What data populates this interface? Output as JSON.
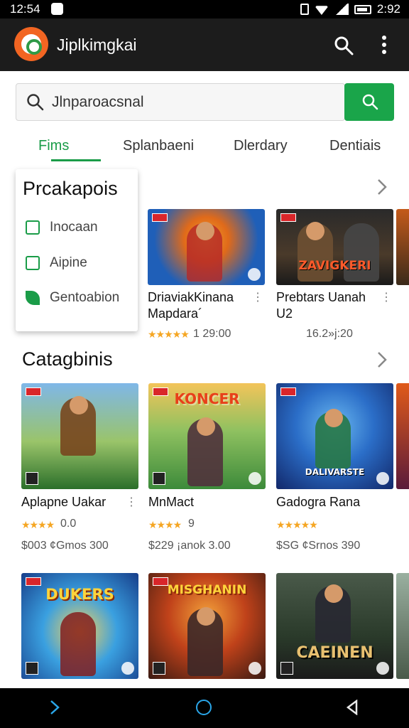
{
  "status_bar": {
    "time_left": "12:54",
    "time_right": "2:92"
  },
  "app_bar": {
    "title": "Jiplkimgkai",
    "icons": [
      "app-logo-icon",
      "search-icon",
      "more-vert-icon"
    ]
  },
  "search": {
    "value": "Jlnparoacsnal",
    "button_icon": "search-icon"
  },
  "tabs": [
    {
      "label": "Fims",
      "active": true
    },
    {
      "label": "Splanbaeni",
      "active": false
    },
    {
      "label": "Dlerdary",
      "active": false
    },
    {
      "label": "Dentiais",
      "active": false
    }
  ],
  "dropdown": {
    "title": "Prcakapois",
    "items": [
      {
        "label": "Inocaan",
        "icon": "square-icon"
      },
      {
        "label": "Aipine",
        "icon": "page-icon"
      },
      {
        "label": "Gentoabion",
        "icon": "leaf-icon"
      }
    ]
  },
  "section1": {
    "cards": [
      {
        "name": "DriaviakKinana Mapdara´",
        "stars": "★★★★★",
        "rating": "1 29:00",
        "art_title": "",
        "colors": [
          "#1f5fb8",
          "#f0a02a"
        ]
      },
      {
        "name": "Prebtars Uanah U2",
        "stars": "",
        "rating": "16.2»j:20",
        "art_title": "ZAVIGKERI",
        "colors": [
          "#1a1a1a",
          "#4a3a2a"
        ]
      }
    ]
  },
  "section2": {
    "title": "Catagbinis",
    "cards": [
      {
        "name": "Aplapne Uakar",
        "stars": "★★★★",
        "rating": "0.0",
        "price": "$003 ¢Gmos 300",
        "art_title": "",
        "colors": [
          "#2b6f2a",
          "#f2a640"
        ]
      },
      {
        "name": "MnMact",
        "stars": "★★★★",
        "rating": "9",
        "price": "$229 ¡anok 3.00",
        "art_title": "KONCER",
        "colors": [
          "#3c8a3a",
          "#e89a30"
        ]
      },
      {
        "name": "Gadogra Rana",
        "stars": "★★★★★",
        "rating": "",
        "price": "$SG ¢Srnos 390",
        "art_title": "DALIVARSTE",
        "colors": [
          "#1c3e8e",
          "#2b8ed8"
        ]
      }
    ]
  },
  "section3": {
    "cards": [
      {
        "art_title": "DUKERS",
        "colors": [
          "#1e4ea8",
          "#f0a02a"
        ]
      },
      {
        "art_title": "MISGHANIN",
        "colors": [
          "#5a2a1a",
          "#e85a20"
        ]
      },
      {
        "art_title": "CAEINEN",
        "colors": [
          "#2a3a2a",
          "#6a7a5a"
        ]
      }
    ]
  },
  "nav_bar": {
    "icons": [
      "back-icon",
      "home-icon",
      "recent-icon"
    ]
  }
}
